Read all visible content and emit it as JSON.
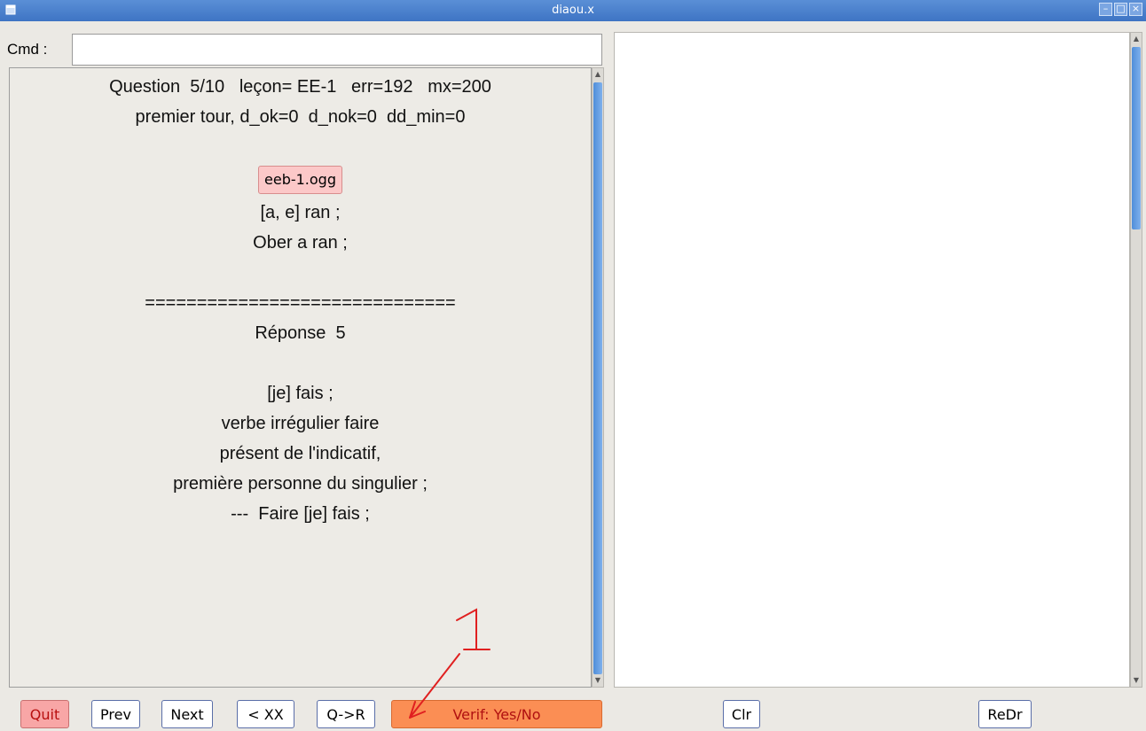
{
  "window": {
    "title": "diaou.x"
  },
  "cmd": {
    "label": "Cmd :",
    "value": ""
  },
  "question": {
    "line1": "Question  5/10   leçon= EE-1   err=192   mx=200",
    "line2": "premier tour, d_ok=0  d_nok=0  dd_min=0",
    "audio_button": "eeb-1.ogg",
    "line3": "[a, e] ran ;",
    "line4": "Ober a ran ;",
    "separator": "==============================",
    "response_title": "Réponse  5",
    "resp1": "[je] fais ;",
    "resp2": "verbe irrégulier faire",
    "resp3": "présent de l'indicatif,",
    "resp4": "première personne du singulier ;",
    "resp5": "---  Faire [je] fais ;"
  },
  "buttons": {
    "quit": "Quit",
    "prev": "Prev",
    "next": "Next",
    "back_xx": "< XX",
    "q_r": "Q->R",
    "verif": "Verif: Yes/No",
    "clr": "Clr",
    "redr": "ReDr"
  },
  "annotation": {
    "label": "1",
    "color": "#e02020"
  },
  "colors": {
    "titlebar": "#4a80cc",
    "quit_bg": "#f8a6a6",
    "verif_bg": "#fb8e54",
    "audio_bg": "#fcc8c8",
    "scroll_thumb": "#5b9ae0"
  }
}
